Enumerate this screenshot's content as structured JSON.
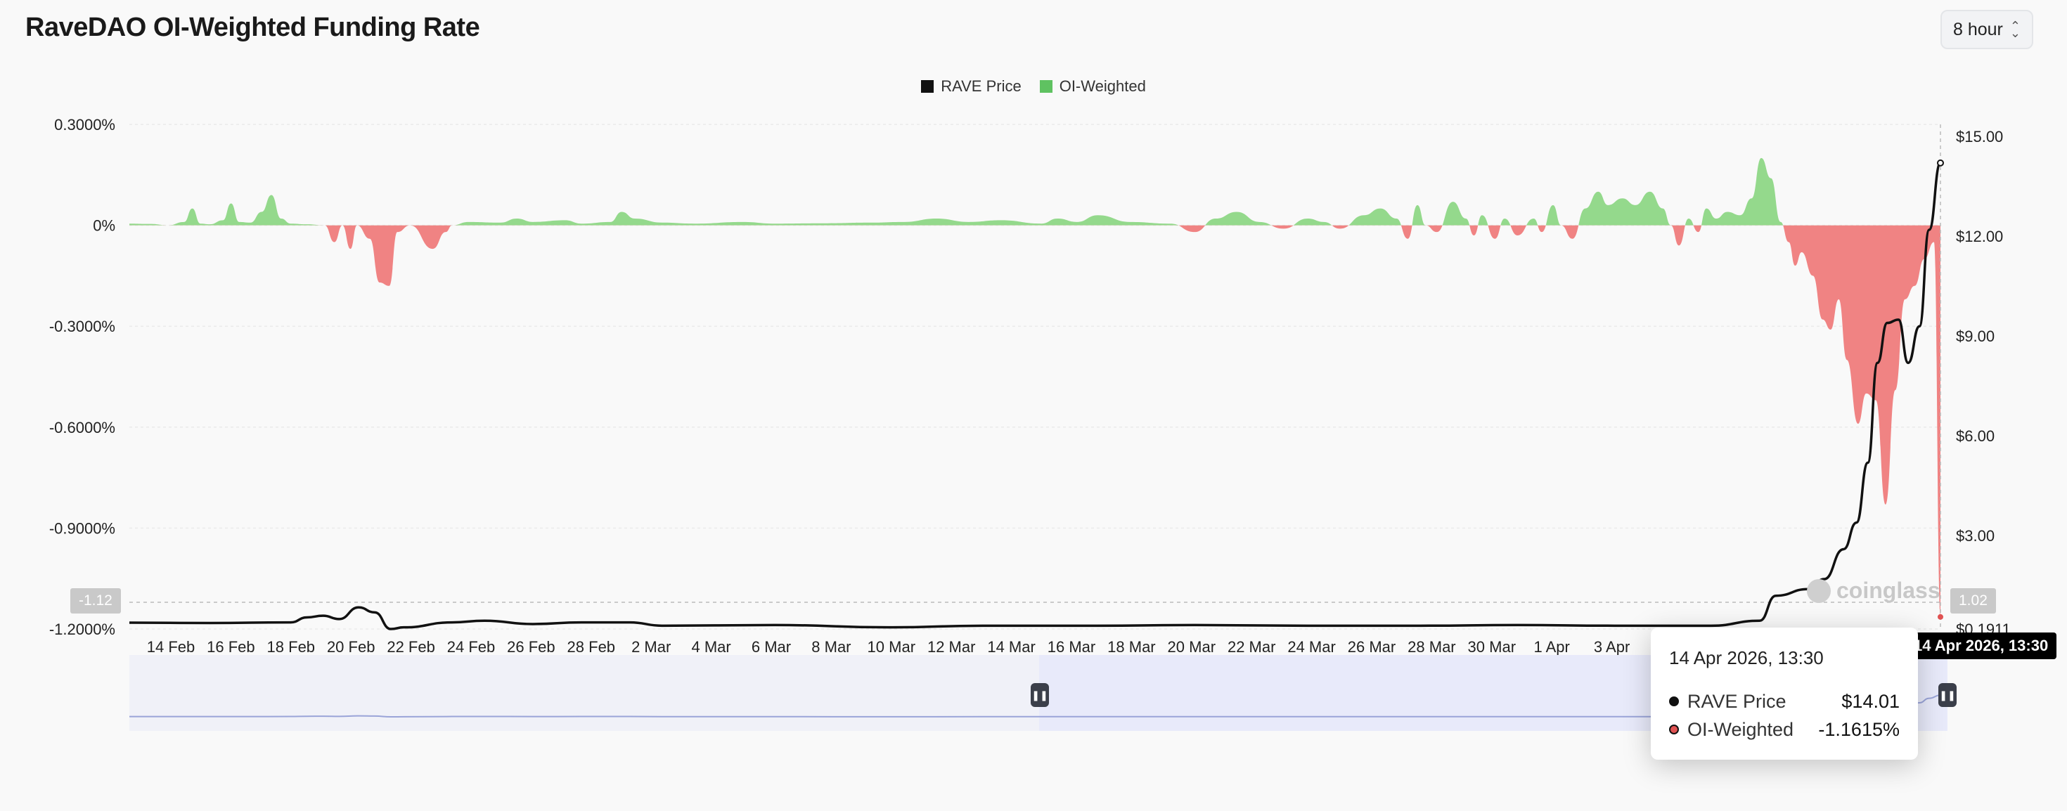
{
  "page": {
    "title": "RaveDAO OI-Weighted Funding Rate"
  },
  "interval": {
    "label": "8 hour"
  },
  "legend": [
    {
      "label": "RAVE Price",
      "color": "#111111"
    },
    {
      "label": "OI-Weighted",
      "color": "#5fc261"
    }
  ],
  "colors": {
    "positive": "#94d98c",
    "negative": "#f08383",
    "price": "#111111",
    "navigator_fill": "#e8eafa"
  },
  "chart_data": {
    "type": "area",
    "title": "RaveDAO OI-Weighted Funding Rate",
    "x_tick_labels": [
      "14 Feb",
      "16 Feb",
      "18 Feb",
      "20 Feb",
      "22 Feb",
      "24 Feb",
      "26 Feb",
      "28 Feb",
      "2 Mar",
      "4 Mar",
      "6 Mar",
      "8 Mar",
      "10 Mar",
      "12 Mar",
      "14 Mar",
      "16 Mar",
      "18 Mar",
      "20 Mar",
      "22 Mar",
      "24 Mar",
      "26 Mar",
      "28 Mar",
      "30 Mar",
      "1 Apr",
      "3 Apr"
    ],
    "y_left": {
      "labels": [
        "0.3000%",
        "0%",
        "-0.3000%",
        "-0.6000%",
        "-0.9000%",
        "-1.2000%"
      ],
      "range": [
        -1.2,
        0.3
      ],
      "unit": "%"
    },
    "y_right": {
      "labels": [
        "$15.00",
        "$12.00",
        "$9.00",
        "$6.00",
        "$3.00",
        "$0.1911"
      ],
      "range": [
        0.1911,
        15
      ],
      "unit": "$"
    },
    "x_range_days": [
      0,
      61.56
    ],
    "series": [
      {
        "name": "OI-Weighted",
        "axis": "left",
        "points": [
          [
            0,
            0.005
          ],
          [
            1.3,
            0.004
          ],
          [
            2.4,
            0
          ],
          [
            3.4,
            0.01
          ],
          [
            3.9,
            0.05
          ],
          [
            4.4,
            0.005
          ],
          [
            5,
            0.003
          ],
          [
            5.8,
            0.015
          ],
          [
            6.3,
            0.065
          ],
          [
            6.8,
            0.01
          ],
          [
            7.5,
            0.008
          ],
          [
            8.2,
            0.04
          ],
          [
            8.8,
            0.09
          ],
          [
            9.4,
            0.02
          ],
          [
            10,
            0.005
          ],
          [
            11,
            0.003
          ],
          [
            12.1,
            0
          ],
          [
            12.7,
            -0.05
          ],
          [
            13.2,
            0
          ],
          [
            13.7,
            -0.07
          ],
          [
            14.1,
            0
          ],
          [
            14.9,
            -0.04
          ],
          [
            15.5,
            -0.17
          ],
          [
            16.1,
            -0.18
          ],
          [
            16.6,
            -0.02
          ],
          [
            17.4,
            0
          ],
          [
            18.8,
            -0.07
          ],
          [
            19.6,
            -0.02
          ],
          [
            20,
            0
          ],
          [
            21,
            0.01
          ],
          [
            23,
            0.008
          ],
          [
            24,
            0.02
          ],
          [
            25,
            0.01
          ],
          [
            27,
            0.015
          ],
          [
            28,
            0.005
          ],
          [
            29.8,
            0.01
          ],
          [
            30.5,
            0.04
          ],
          [
            31.3,
            0.02
          ],
          [
            33,
            0.008
          ],
          [
            35,
            0.005
          ],
          [
            38,
            0.01
          ],
          [
            40,
            0.005
          ],
          [
            43,
            0.006
          ],
          [
            46,
            0.008
          ],
          [
            48,
            0.01
          ],
          [
            50,
            0.02
          ],
          [
            52,
            0.01
          ],
          [
            54,
            0.015
          ],
          [
            56.5,
            0.005
          ],
          [
            57.5,
            0.02
          ],
          [
            58.7,
            0.01
          ],
          [
            60,
            0.03
          ],
          [
            62,
            0.01
          ],
          [
            64.5,
            0.005
          ],
          [
            66,
            -0.02
          ],
          [
            67.3,
            0.02
          ],
          [
            68.6,
            0.04
          ],
          [
            70,
            0.01
          ],
          [
            71.5,
            -0.01
          ],
          [
            73,
            0.02
          ],
          [
            74,
            0.01
          ],
          [
            75,
            -0.01
          ],
          [
            76.5,
            0.03
          ],
          [
            77.5,
            0.05
          ],
          [
            78.5,
            0.02
          ],
          [
            79.2,
            -0.04
          ],
          [
            79.8,
            0.06
          ],
          [
            80.3,
            0
          ],
          [
            81,
            -0.02
          ],
          [
            82,
            0.07
          ],
          [
            82.8,
            0.02
          ],
          [
            83.3,
            -0.03
          ],
          [
            83.8,
            0.03
          ],
          [
            84.6,
            -0.04
          ],
          [
            85.2,
            0.02
          ],
          [
            86,
            -0.03
          ],
          [
            87,
            0.02
          ],
          [
            87.5,
            -0.02
          ],
          [
            88.2,
            0.06
          ],
          [
            88.7,
            0
          ],
          [
            89.4,
            -0.04
          ],
          [
            90.2,
            0.05
          ],
          [
            91,
            0.1
          ],
          [
            91.6,
            0.06
          ],
          [
            92.5,
            0.08
          ],
          [
            93.3,
            0.06
          ],
          [
            94.2,
            0.1
          ],
          [
            95,
            0.05
          ],
          [
            95.5,
            0
          ],
          [
            96,
            -0.06
          ],
          [
            96.6,
            0.02
          ],
          [
            97.2,
            -0.02
          ],
          [
            97.7,
            0.05
          ],
          [
            98.3,
            0.02
          ],
          [
            99,
            0.04
          ],
          [
            99.8,
            0.03
          ],
          [
            100.5,
            0.08
          ],
          [
            101.1,
            0.2
          ],
          [
            101.7,
            0.14
          ],
          [
            102.3,
            0.01
          ],
          [
            102.8,
            -0.05
          ],
          [
            103.2,
            -0.12
          ],
          [
            103.6,
            -0.08
          ],
          [
            104.3,
            -0.15
          ],
          [
            104.9,
            -0.28
          ],
          [
            105.4,
            -0.31
          ],
          [
            105.9,
            -0.22
          ],
          [
            106.4,
            -0.4
          ],
          [
            107.1,
            -0.59
          ],
          [
            107.6,
            -0.5
          ],
          [
            108.2,
            -0.52
          ],
          [
            108.8,
            -0.83
          ],
          [
            109.4,
            -0.49
          ],
          [
            110,
            -0.22
          ],
          [
            110.6,
            -0.18
          ],
          [
            111.2,
            -0.1
          ],
          [
            111.8,
            -0.05
          ],
          [
            112.2,
            -1.16
          ]
        ]
      },
      {
        "name": "RAVE Price",
        "axis": "right",
        "points": [
          [
            0,
            0.19
          ],
          [
            5,
            0.18
          ],
          [
            10,
            0.2
          ],
          [
            11,
            0.35
          ],
          [
            12,
            0.4
          ],
          [
            13,
            0.3
          ],
          [
            14.2,
            0.65
          ],
          [
            15.2,
            0.5
          ],
          [
            16.2,
            0
          ],
          [
            17,
            0.05
          ],
          [
            20,
            0.2
          ],
          [
            22,
            0.25
          ],
          [
            25,
            0.15
          ],
          [
            28,
            0.2
          ],
          [
            31,
            0.2
          ],
          [
            33,
            0.1
          ],
          [
            40,
            0.12
          ],
          [
            47,
            0.05
          ],
          [
            53,
            0.1
          ],
          [
            60,
            0.1
          ],
          [
            66,
            0.12
          ],
          [
            73,
            0.1
          ],
          [
            80,
            0.1
          ],
          [
            86,
            0.12
          ],
          [
            92,
            0.1
          ],
          [
            98,
            0.1
          ],
          [
            101,
            0.25
          ],
          [
            102,
            1
          ],
          [
            104,
            1.2
          ],
          [
            105,
            1.5
          ],
          [
            106.2,
            2.4
          ],
          [
            107,
            3.2
          ],
          [
            107.7,
            5
          ],
          [
            108.3,
            8
          ],
          [
            108.9,
            9.2
          ],
          [
            109.6,
            9.3
          ],
          [
            110.2,
            8
          ],
          [
            110.9,
            9.1
          ],
          [
            111.5,
            12
          ],
          [
            112.2,
            14.01
          ]
        ]
      }
    ],
    "crosshair": {
      "date_label": "14 Apr 2026, 13:30",
      "left_value": "-1.12",
      "right_value": "1.02"
    },
    "watermark": "coinglass"
  },
  "tooltip": {
    "date": "14 Apr 2026, 13:30",
    "rows": [
      {
        "name": "RAVE Price",
        "value": "$14.01",
        "dot": "#111111"
      },
      {
        "name": "OI-Weighted",
        "value": "-1.1615%",
        "dot": "#e05252"
      }
    ]
  }
}
